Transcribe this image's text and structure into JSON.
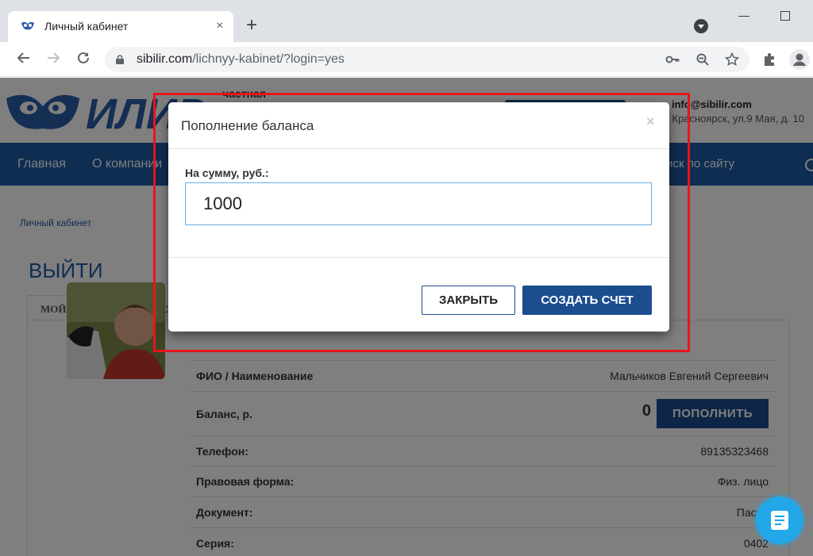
{
  "browser": {
    "tab_title": "Личный кабинет",
    "tab_close": "×",
    "new_tab": "+",
    "url_domain": "sibilir.com",
    "url_path": "/lichnyy-kabinet/?login=yes"
  },
  "site_header": {
    "logo_text": "ИЛИР",
    "logo_subtitle": "частная",
    "email": "info@sibilir.com",
    "address": "г. Красноярск, ул.9 Мая, д. 10"
  },
  "nav": {
    "items": [
      "Главная",
      "О компании",
      "Поиск по сайту"
    ]
  },
  "page": {
    "breadcrumb": "Личный кабинет",
    "heading": "ВЫЙТИ",
    "tab_profile": "МОЙ ПРОФИЛЬ",
    "tab_second": "С"
  },
  "profile": {
    "rows": [
      {
        "label": "ФИО / Наименование",
        "value": "Мальчиков Евгений Сергеевич"
      },
      {
        "label": "Баланс, р.",
        "value": "0",
        "button": "ПОПОЛНИТЬ"
      },
      {
        "label": "Телефон:",
        "value": "89135323468"
      },
      {
        "label": "Правовая форма:",
        "value": "Физ. лицо"
      },
      {
        "label": "Документ:",
        "value": "Паспо"
      },
      {
        "label": "Серия:",
        "value": "0402"
      }
    ]
  },
  "modal": {
    "title": "Пополнение баланса",
    "close_symbol": "×",
    "field_label": "На сумму, руб.:",
    "amount_value": "1000",
    "close_button": "ЗАКРЫТЬ",
    "submit_button": "СОЗДАТЬ СЧЕТ"
  },
  "colors": {
    "brand_blue": "#1b4d8f",
    "nav_blue": "#1d5aa3",
    "highlight_red": "#e8141b",
    "chat_blue": "#22a7e8"
  }
}
